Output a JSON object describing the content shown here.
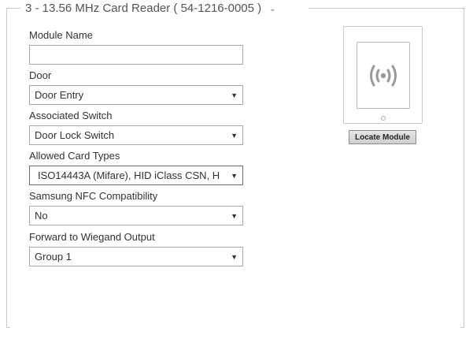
{
  "module": {
    "title": "3 - 13.56 MHz Card Reader ( 54-1216-0005 )",
    "collapse_icon": "chevron-down-icon"
  },
  "fields": {
    "module_name": {
      "label": "Module Name",
      "value": "",
      "placeholder": ""
    },
    "door": {
      "label": "Door",
      "value": "Door Entry"
    },
    "associated_switch": {
      "label": "Associated Switch",
      "value": "Door Lock Switch"
    },
    "allowed_card_types": {
      "label": "Allowed Card Types",
      "value": "ISO14443A (Mifare), HID iClass CSN, H"
    },
    "samsung_nfc": {
      "label": "Samsung NFC Compatibility",
      "value": "No"
    },
    "forward_wiegand": {
      "label": "Forward to Wiegand Output",
      "value": "Group 1"
    }
  },
  "device_preview": {
    "icon": "rfid-signal-icon",
    "locate_label": "Locate Module"
  },
  "colors": {
    "frame": "#c8c8c8",
    "text": "#333333",
    "icon": "#9a9a9a"
  }
}
